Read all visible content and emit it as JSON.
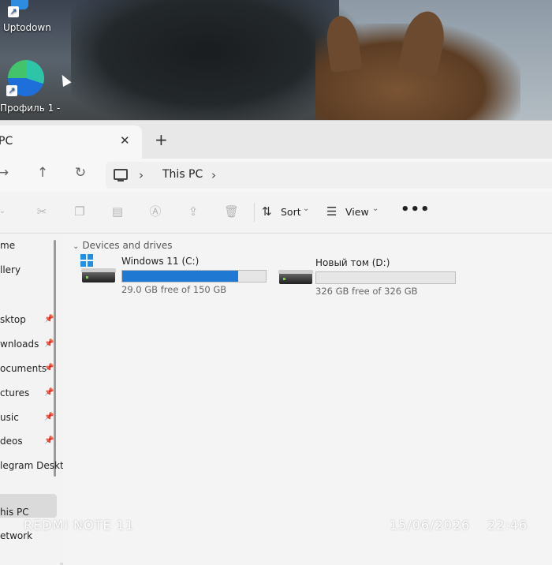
{
  "desktop": {
    "icons": [
      {
        "label": "Uptodown"
      },
      {
        "label": "Профиль 1 -"
      }
    ]
  },
  "window": {
    "tab_title": "PC",
    "tab_close": "✕",
    "new_tab": "+",
    "nav": {
      "forward": "→",
      "up": "↑",
      "refresh": "↻"
    },
    "address": {
      "chevron": "›",
      "path": "This PC"
    },
    "commands": {
      "sort_label": "Sort",
      "view_label": "View",
      "more_label": "•••",
      "dropdown_chev": "⌄"
    },
    "sidebar": {
      "items": [
        {
          "label": "me",
          "pinned": false
        },
        {
          "label": "llery",
          "pinned": false
        },
        {
          "label": "sktop",
          "pinned": true
        },
        {
          "label": "wnloads",
          "pinned": true
        },
        {
          "label": "ocuments",
          "pinned": true
        },
        {
          "label": "ctures",
          "pinned": true
        },
        {
          "label": "usic",
          "pinned": true
        },
        {
          "label": "deos",
          "pinned": true
        },
        {
          "label": "legram Deskto",
          "pinned": false
        },
        {
          "label": "his PC",
          "pinned": false,
          "selected": true
        },
        {
          "label": "etwork",
          "pinned": false
        }
      ]
    },
    "content": {
      "group_title": "Devices and drives",
      "drives": [
        {
          "name": "Windows 11 (C:)",
          "free_text": "29.0 GB free of 150 GB",
          "used_fraction": 0.807
        },
        {
          "name": "Новый том (D:)",
          "free_text": "326 GB free of 326 GB",
          "used_fraction": 0.0
        }
      ]
    }
  },
  "watermark": {
    "device": "REDMI NOTE 11",
    "date": "15/06/2026",
    "time": "22:46"
  },
  "colors": {
    "accent": "#1f78d1"
  }
}
